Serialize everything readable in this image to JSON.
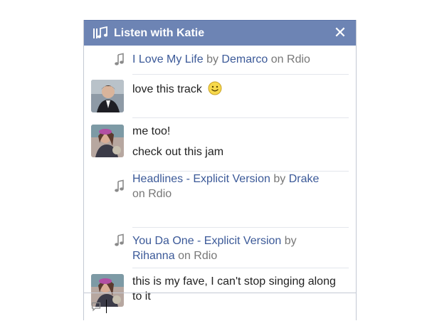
{
  "chat": {
    "title": "Listen with Katie",
    "accent_color": "#6d84b4",
    "link_color": "#3b5998",
    "close_icon": "close-icon",
    "title_icon": "music-icon"
  },
  "items": [
    {
      "kind": "track",
      "song": "I Love My Life",
      "by": "by",
      "artist": "Demarco",
      "on": "on Rdio"
    },
    {
      "kind": "message",
      "text": "love this track",
      "emoji": "smiley-face"
    },
    {
      "kind": "message",
      "lines": [
        "me too!",
        "check out this jam"
      ]
    },
    {
      "kind": "track",
      "song": "Headlines - Explicit Version",
      "by": "by",
      "artist": "Drake",
      "on": "on Rdio"
    },
    {
      "kind": "track",
      "song": "You Da One - Explicit Version",
      "by": "by",
      "artist": "Rihanna",
      "on": "on Rdio"
    },
    {
      "kind": "message",
      "text": "this is my fave, I can't stop singing along to it"
    }
  ],
  "composer": {
    "value": "",
    "icon": "speech-bubble-icon"
  }
}
